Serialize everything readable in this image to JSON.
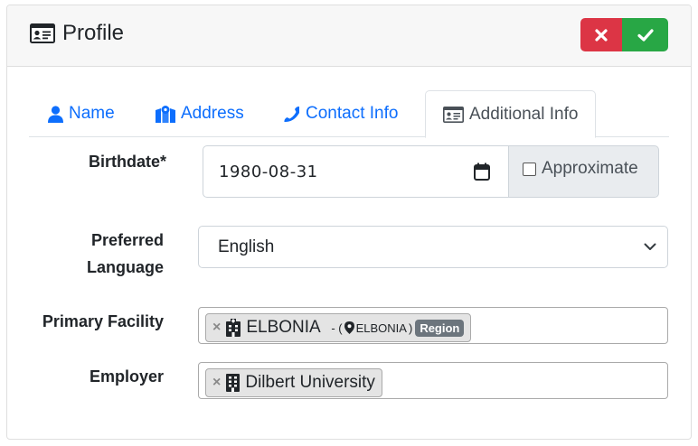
{
  "header": {
    "title": "Profile",
    "cancel_icon": "x-mark-icon",
    "confirm_icon": "checkmark-icon"
  },
  "tabs": [
    {
      "label": "Name",
      "icon": "user-icon"
    },
    {
      "label": "Address",
      "icon": "map-icon"
    },
    {
      "label": "Contact Info",
      "icon": "phone-icon"
    },
    {
      "label": "Additional Info",
      "icon": "id-card-icon",
      "active": true
    }
  ],
  "form": {
    "birthdate": {
      "label": "Birthdate*",
      "value": "1980-08-31",
      "approximate_label": "Approximate",
      "approximate_checked": false
    },
    "language": {
      "label_line1": "Preferred",
      "label_line2": "Language",
      "value": "English"
    },
    "primary_facility": {
      "label": "Primary Facility",
      "chip_label": "ELBONIA",
      "chip_parent": "ELBONIA",
      "chip_badge": "Region"
    },
    "employer": {
      "label": "Employer",
      "chip_label": "Dilbert University"
    }
  },
  "colors": {
    "accent": "#0d6efd",
    "danger": "#dc3545",
    "success": "#28a745",
    "badge": "#6c757d"
  }
}
